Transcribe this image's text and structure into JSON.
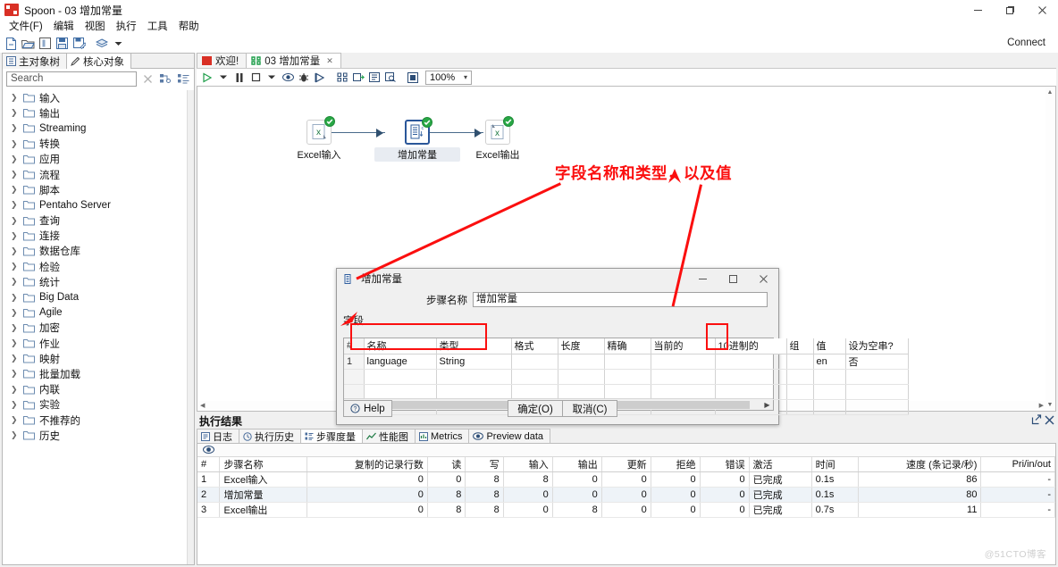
{
  "window": {
    "title": "Spoon - 03 增加常量",
    "icon": "spoon-app-icon",
    "controls": {
      "minimize": "−",
      "maximize": "▢",
      "close": "✕"
    }
  },
  "menubar": {
    "items": [
      {
        "label": "文件(F)",
        "accel": "F"
      },
      {
        "label": "编辑"
      },
      {
        "label": "视图"
      },
      {
        "label": "执行"
      },
      {
        "label": "工具"
      },
      {
        "label": "帮助"
      }
    ]
  },
  "toolbar": {
    "buttons": [
      {
        "name": "new-file-icon"
      },
      {
        "name": "open-file-icon"
      },
      {
        "name": "explorer-icon"
      },
      {
        "name": "save-icon"
      },
      {
        "name": "save-as-icon"
      },
      {
        "name": "repository-icon"
      },
      {
        "name": "dropdown-caret-icon"
      }
    ],
    "connect_label": "Connect"
  },
  "sidebar": {
    "tabs": [
      {
        "label": "主对象树",
        "icon": "tree-icon",
        "active": false
      },
      {
        "label": "核心对象",
        "icon": "pencil-icon",
        "active": true
      }
    ],
    "search": {
      "placeholder": "Search",
      "value": "",
      "clear_icon": "clear-icon"
    },
    "toolbuttons": [
      {
        "name": "collapse-all-icon"
      },
      {
        "name": "expand-all-icon"
      }
    ],
    "items": [
      {
        "label": "输入"
      },
      {
        "label": "输出"
      },
      {
        "label": "Streaming"
      },
      {
        "label": "转换"
      },
      {
        "label": "应用"
      },
      {
        "label": "流程"
      },
      {
        "label": "脚本"
      },
      {
        "label": "Pentaho Server"
      },
      {
        "label": "查询"
      },
      {
        "label": "连接"
      },
      {
        "label": "数据仓库"
      },
      {
        "label": "检验"
      },
      {
        "label": "统计"
      },
      {
        "label": "Big Data"
      },
      {
        "label": "Agile"
      },
      {
        "label": "加密"
      },
      {
        "label": "作业"
      },
      {
        "label": "映射"
      },
      {
        "label": "批量加载"
      },
      {
        "label": "内联"
      },
      {
        "label": "实验"
      },
      {
        "label": "不推荐的"
      },
      {
        "label": "历史"
      }
    ]
  },
  "editor": {
    "tabs": [
      {
        "label": "欢迎!",
        "icon": "welcome-icon",
        "active": false,
        "closable": false
      },
      {
        "label": "03 增加常量",
        "icon": "transformation-icon",
        "active": true,
        "closable": true
      }
    ],
    "toolbar": {
      "buttons": [
        {
          "name": "run-icon"
        },
        {
          "name": "run-options-caret-icon"
        },
        {
          "name": "pause-icon"
        },
        {
          "name": "stop-icon"
        },
        {
          "name": "stop-options-caret-icon"
        },
        {
          "name": "preview-icon"
        },
        {
          "name": "debug-icon"
        },
        {
          "name": "replay-icon"
        },
        {
          "name": "verify-icon"
        },
        {
          "name": "impact-analysis-icon"
        },
        {
          "name": "generate-sql-icon"
        },
        {
          "name": "explore-database-icon"
        },
        {
          "name": "show-grid-icon"
        }
      ],
      "zoom": "100%"
    },
    "steps": [
      {
        "name": "Excel输入",
        "icon": "excel-input-icon",
        "status": "ok",
        "selected": false
      },
      {
        "name": "增加常量",
        "icon": "add-constants-icon",
        "status": "ok",
        "selected": true
      },
      {
        "name": "Excel输出",
        "icon": "excel-output-icon",
        "status": "ok",
        "selected": false
      }
    ],
    "annotation": {
      "text": "字段名称和类型，以及值",
      "color": "#fb0f0f"
    }
  },
  "dialog": {
    "title": "增加常量",
    "icon": "add-constants-icon",
    "controls": {
      "minimize": "−",
      "maximize": "▢",
      "close": "✕"
    },
    "step_name_label": "步骤名称",
    "step_name_value": "增加常量",
    "fields_label": "字段",
    "grid": {
      "columns": [
        "#",
        "名称",
        "类型",
        "格式",
        "长度",
        "精确",
        "当前的",
        "10进制的",
        "组",
        "值",
        "设为空串?"
      ],
      "rows": [
        {
          "index": "1",
          "名称": "language",
          "类型": "String",
          "格式": "",
          "长度": "",
          "精确": "",
          "当前的": "",
          "10进制的": "",
          "组": "",
          "值": "en",
          "设为空串?": "否"
        }
      ],
      "empty_rows": 3
    },
    "buttons": {
      "help": "Help",
      "ok": "确定(O)",
      "cancel": "取消(C)"
    }
  },
  "results": {
    "title": "执行结果",
    "header_icons": [
      {
        "name": "maximize-panel-icon"
      },
      {
        "name": "close-panel-icon"
      }
    ],
    "tabs": [
      {
        "label": "日志",
        "icon": "log-icon",
        "active": false
      },
      {
        "label": "执行历史",
        "icon": "history-icon",
        "active": false
      },
      {
        "label": "步骤度量",
        "icon": "step-metrics-icon",
        "active": true
      },
      {
        "label": "性能图",
        "icon": "performance-graph-icon",
        "active": false
      },
      {
        "label": "Metrics",
        "icon": "metrics-icon",
        "active": false
      },
      {
        "label": "Preview data",
        "icon": "preview-data-icon",
        "active": false
      }
    ],
    "toolbar_icons": [
      {
        "name": "eye-icon"
      }
    ],
    "table": {
      "columns": [
        "#",
        "步骤名称",
        "复制的记录行数",
        "读",
        "写",
        "输入",
        "输出",
        "更新",
        "拒绝",
        "错误",
        "激活",
        "时间",
        "速度 (条记录/秒)",
        "Pri/in/out"
      ],
      "rows": [
        [
          "1",
          "Excel输入",
          "0",
          "0",
          "8",
          "8",
          "0",
          "0",
          "0",
          "0",
          "已完成",
          "0.1s",
          "86",
          "-"
        ],
        [
          "2",
          "增加常量",
          "0",
          "8",
          "8",
          "0",
          "0",
          "0",
          "0",
          "0",
          "已完成",
          "0.1s",
          "80",
          "-"
        ],
        [
          "3",
          "Excel输出",
          "0",
          "8",
          "8",
          "0",
          "8",
          "0",
          "0",
          "0",
          "已完成",
          "0.7s",
          "11",
          "-"
        ]
      ]
    }
  },
  "watermark": "@51CTO博客"
}
